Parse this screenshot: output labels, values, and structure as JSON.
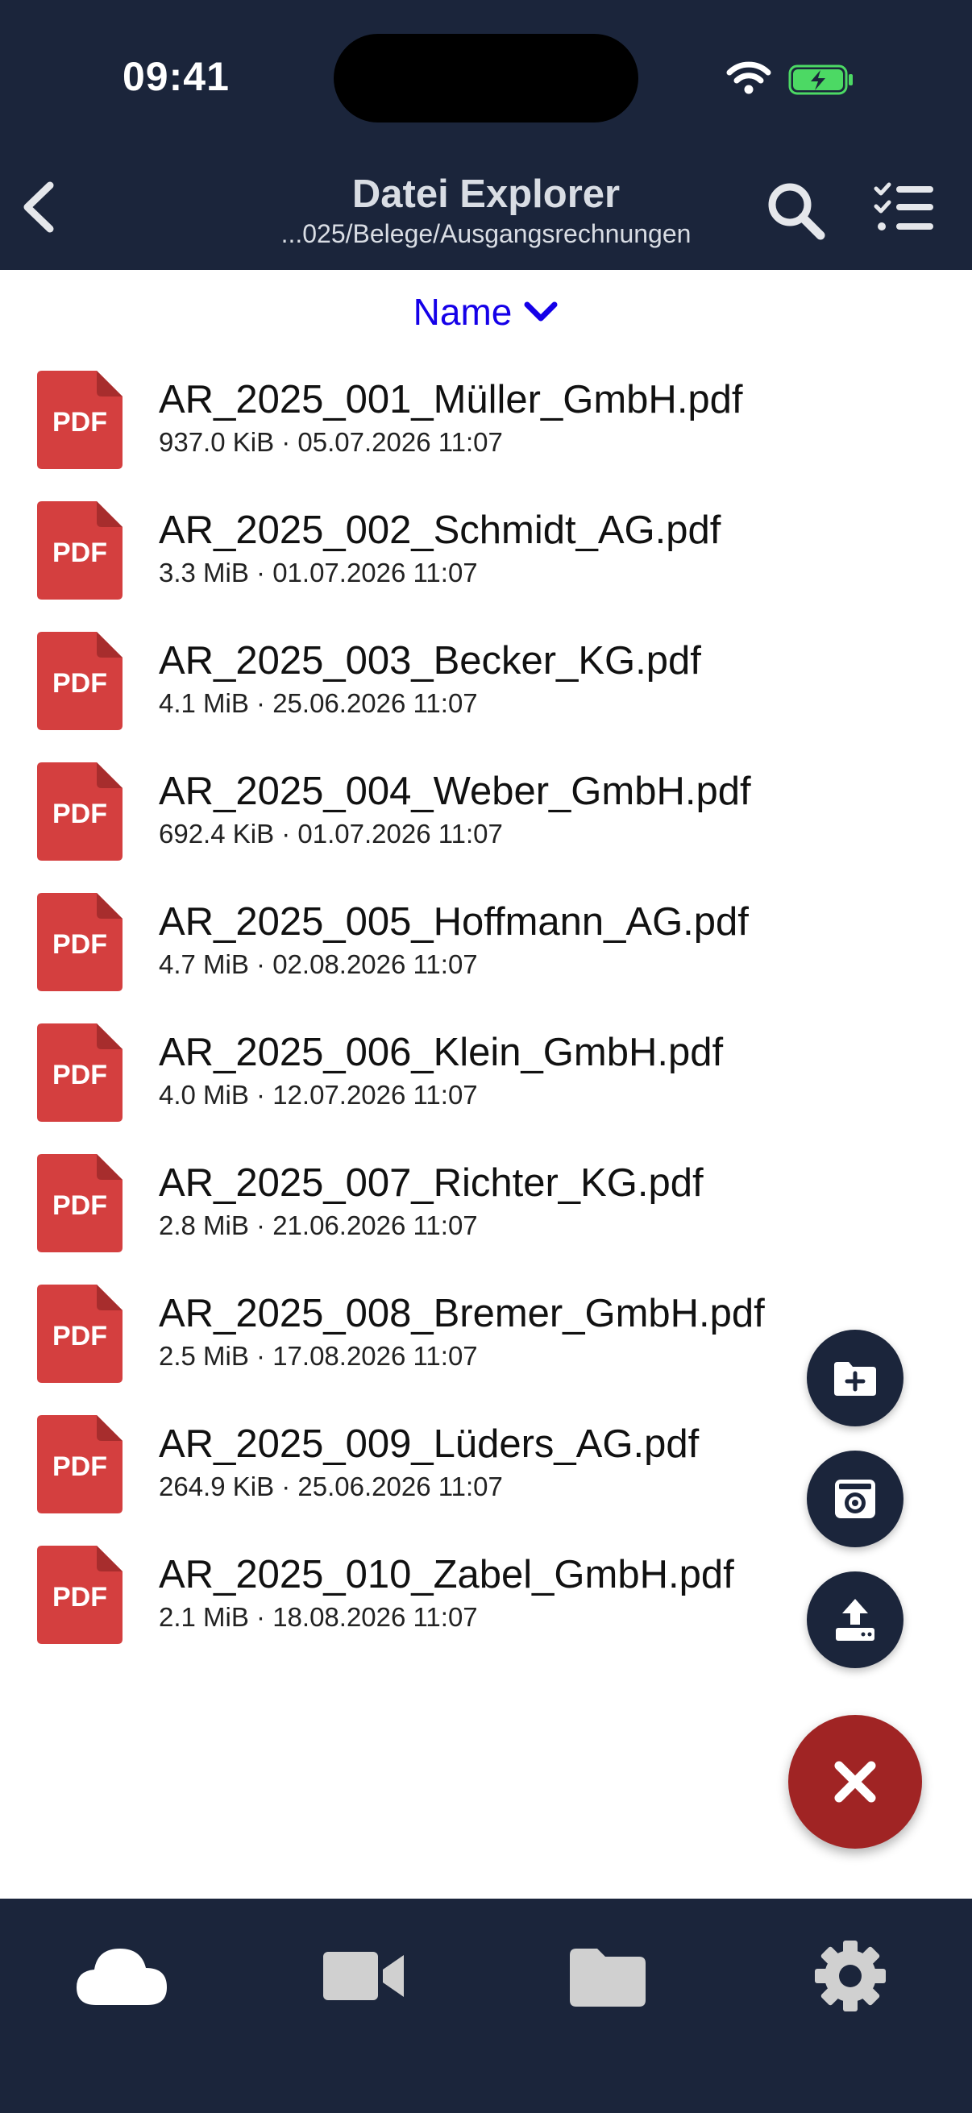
{
  "status_bar": {
    "time": "09:41"
  },
  "header": {
    "title": "Datei Explorer",
    "path": "...025/Belege/Ausgangsrechnungen"
  },
  "sort": {
    "label": "Name"
  },
  "pdf_icon_label": "PDF",
  "files": [
    {
      "name": "AR_2025_001_Müller_GmbH.pdf",
      "meta": "937.0 KiB · 05.07.2026 11:07"
    },
    {
      "name": "AR_2025_002_Schmidt_AG.pdf",
      "meta": "3.3 MiB · 01.07.2026 11:07"
    },
    {
      "name": "AR_2025_003_Becker_KG.pdf",
      "meta": "4.1 MiB · 25.06.2026 11:07"
    },
    {
      "name": "AR_2025_004_Weber_GmbH.pdf",
      "meta": "692.4 KiB · 01.07.2026 11:07"
    },
    {
      "name": "AR_2025_005_Hoffmann_AG.pdf",
      "meta": "4.7 MiB · 02.08.2026 11:07"
    },
    {
      "name": "AR_2025_006_Klein_GmbH.pdf",
      "meta": "4.0 MiB · 12.07.2026 11:07"
    },
    {
      "name": "AR_2025_007_Richter_KG.pdf",
      "meta": "2.8 MiB · 21.06.2026 11:07"
    },
    {
      "name": "AR_2025_008_Bremer_GmbH.pdf",
      "meta": "2.5 MiB · 17.08.2026 11:07"
    },
    {
      "name": "AR_2025_009_Lüders_AG.pdf",
      "meta": "264.9 KiB · 25.06.2026 11:07"
    },
    {
      "name": "AR_2025_010_Zabel_GmbH.pdf",
      "meta": "2.1 MiB · 18.08.2026 11:07"
    }
  ],
  "fab_actions": [
    "new-folder-icon",
    "camera-icon",
    "upload-icon"
  ],
  "bottom_nav": [
    "cloud-icon",
    "video-camera-icon",
    "folder-icon",
    "gear-icon"
  ],
  "colors": {
    "header_bg": "#1b253b",
    "sort_accent": "#1500e8",
    "pdf_red": "#d43f3f",
    "close_fab": "#a02424",
    "nav_icon": "#d0d0d0",
    "battery_green": "#4cd964"
  }
}
